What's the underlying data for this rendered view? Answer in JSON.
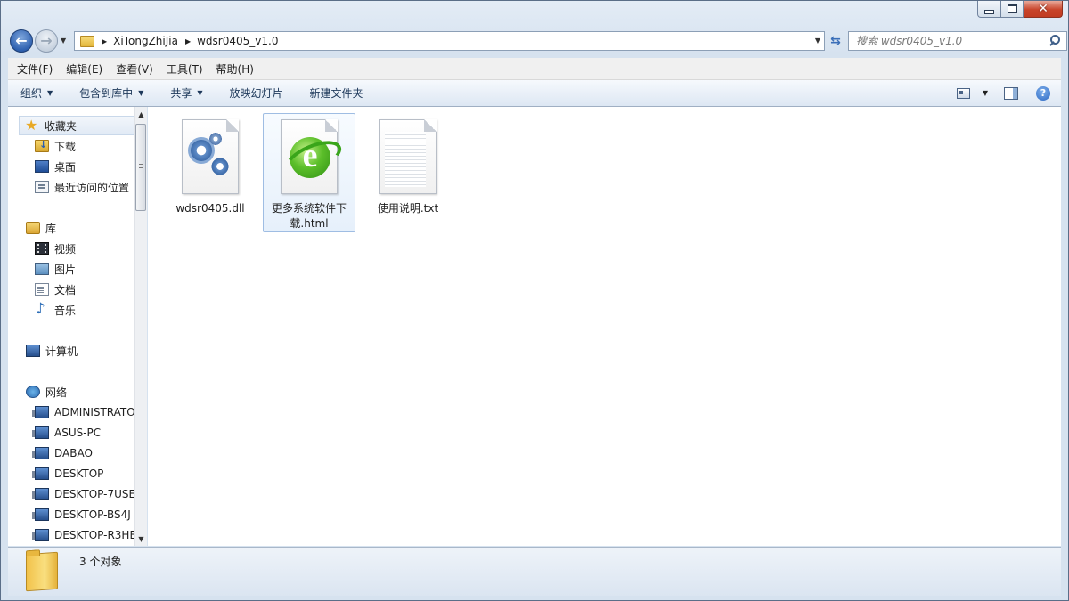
{
  "window": {
    "caption": {
      "minimize": "",
      "maximize": "",
      "close": "✕"
    }
  },
  "address": {
    "crumbs": [
      "XiTongZhiJia",
      "wdsr0405_v1.0"
    ],
    "search_placeholder": "搜索 wdsr0405_v1.0"
  },
  "menu": {
    "items": [
      "文件(F)",
      "编辑(E)",
      "查看(V)",
      "工具(T)",
      "帮助(H)"
    ]
  },
  "toolbar": {
    "organize": "组织",
    "include_in_library": "包含到库中",
    "share": "共享",
    "slideshow": "放映幻灯片",
    "new_folder": "新建文件夹",
    "help": "?"
  },
  "nav": {
    "favorites": "收藏夹",
    "downloads": "下载",
    "desktop": "桌面",
    "recent": "最近访问的位置",
    "libraries": "库",
    "videos": "视频",
    "pictures": "图片",
    "documents": "文档",
    "music": "音乐",
    "computer": "计算机",
    "network": "网络",
    "hosts": [
      "ADMINISTRATOR",
      "ASUS-PC",
      "DABAO",
      "DESKTOP",
      "DESKTOP-7USE",
      "DESKTOP-BS4J",
      "DESKTOP-R3HE"
    ]
  },
  "files": [
    {
      "name": "wdsr0405.dll",
      "icon": "gear-dll-icon",
      "selected": false
    },
    {
      "name": "更多系统软件下载.html",
      "icon": "ie-html-icon",
      "selected": true
    },
    {
      "name": "使用说明.txt",
      "icon": "text-file-icon",
      "selected": false
    }
  ],
  "details": {
    "count": "3 个对象"
  }
}
